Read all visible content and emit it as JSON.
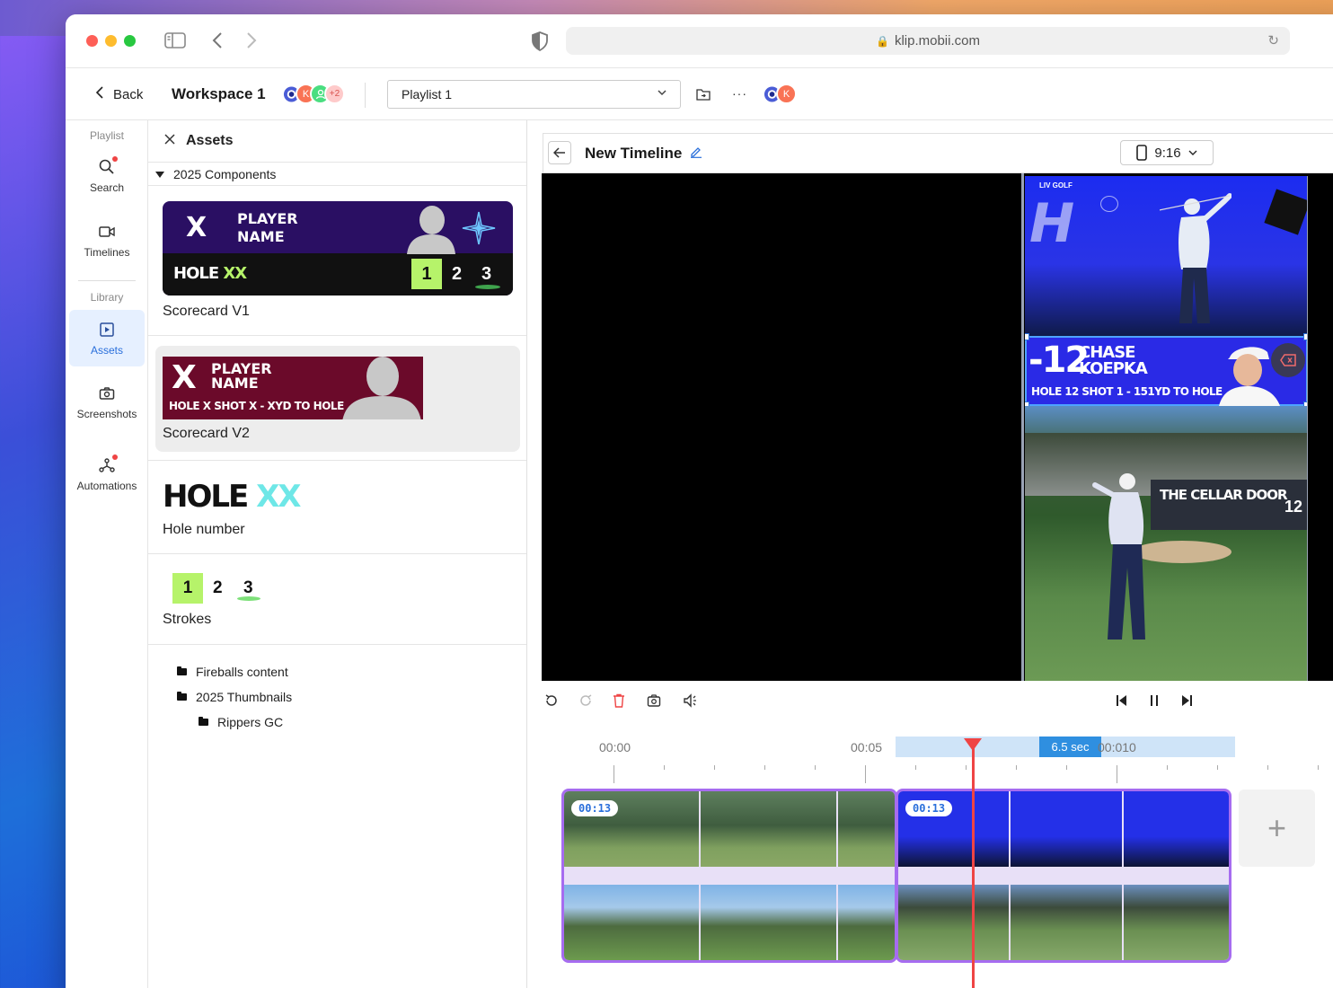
{
  "browser": {
    "url": "klip.mobii.com"
  },
  "header": {
    "back_label": "Back",
    "workspace_title": "Workspace 1",
    "avatars": [
      {
        "initial": "",
        "color": "#4a5cd6"
      },
      {
        "initial": "K",
        "color": "#f97355"
      },
      {
        "initial": "",
        "color": "#4ade80"
      },
      {
        "initial": "+2",
        "color": "#fecaca"
      }
    ],
    "playlist_selected": "Playlist 1",
    "more_label": "···",
    "right_avatar_initial": "K"
  },
  "sidebar": {
    "sections": [
      {
        "heading": "Playlist",
        "items": [
          {
            "label": "Search",
            "icon": "search-icon",
            "notification": true
          },
          {
            "label": "Timelines",
            "icon": "video-icon",
            "notification": false
          }
        ]
      },
      {
        "heading": "Library",
        "items": [
          {
            "label": "Assets",
            "icon": "play-square-icon",
            "active": true
          },
          {
            "label": "Screenshots",
            "icon": "camera-icon"
          },
          {
            "label": "Automations",
            "icon": "network-icon",
            "notification": true
          }
        ]
      }
    ]
  },
  "assets": {
    "title": "Assets",
    "group": "2025 Components",
    "cards": [
      {
        "name": "Scorecard V1",
        "graphic_text": {
          "x": "X",
          "player": "PLAYER",
          "name": "NAME",
          "hole": "HOLE",
          "hole_num": "XX",
          "strokes": [
            "1",
            "2",
            "3"
          ]
        }
      },
      {
        "name": "Scorecard V2",
        "graphic_text": {
          "x": "X",
          "player": "PLAYER",
          "name": "NAME",
          "sub": "HOLE X SHOT X - XYD TO HOLE"
        }
      },
      {
        "name": "Hole number",
        "graphic_text": {
          "hole": "HOLE",
          "num": "XX"
        }
      },
      {
        "name": "Strokes",
        "graphic_text": {
          "strokes": [
            "1",
            "2",
            "3"
          ]
        }
      }
    ],
    "folders": [
      "Fireballs content",
      "2025 Thumbnails",
      "Rippers GC"
    ]
  },
  "editor": {
    "title": "New Timeline",
    "aspect_ratio": "9:16",
    "overlay": {
      "score": "-12",
      "first_name": "CHASE",
      "last_name": "KOEPKA",
      "sub": "HOLE 12 SHOT 1 - 151YD TO HOLE",
      "brand": "LIV GOLF",
      "board_text": "THE CELLAR DOOR",
      "board_num": "12"
    },
    "timeline": {
      "labels": [
        "00:00",
        "00:05",
        "00:010"
      ],
      "selection_label": "6.5 sec",
      "clips": [
        {
          "duration": "00:13"
        },
        {
          "duration": "00:13"
        }
      ],
      "add_label": "+"
    }
  },
  "colors": {
    "accent": "#2a6fdb",
    "track_border": "#a66cf0",
    "playhead": "#ef4444",
    "scorecard_bg": "#2a0f63",
    "scorecard_v2_bg": "#6b0a2a",
    "lime": "#b6f36a",
    "cyan": "#6ee7e7"
  }
}
